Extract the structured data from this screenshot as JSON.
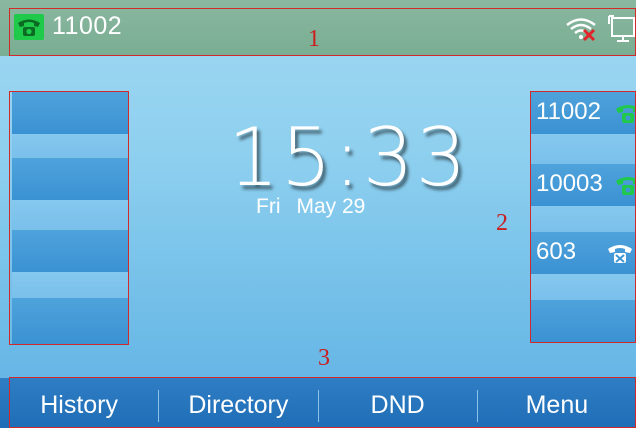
{
  "status_bar": {
    "account": "11002",
    "icons": [
      "phone-icon",
      "wifi-disconnected-icon",
      "network-icon"
    ]
  },
  "clock": {
    "time": "15:33",
    "day": "Fri",
    "date": "May 29"
  },
  "line_keys_right": [
    {
      "label": "11002",
      "icon": "phone-registered-icon",
      "icon_color": "#1fc94a"
    },
    {
      "label": "10003",
      "icon": "phone-registered-icon",
      "icon_color": "#1fc94a"
    },
    {
      "label": "603",
      "icon": "phone-unregistered-icon",
      "icon_color": "#ffffff"
    }
  ],
  "softkeys": [
    "History",
    "Directory",
    "DND",
    "Menu"
  ],
  "annotations": [
    "1",
    "2",
    "3"
  ],
  "colors": {
    "status_bar": "#7fb398",
    "line_key": "#3f96d4",
    "softkey_bar": "#2674bd",
    "registered": "#1fc94a",
    "annotation": "#d12a2a"
  }
}
